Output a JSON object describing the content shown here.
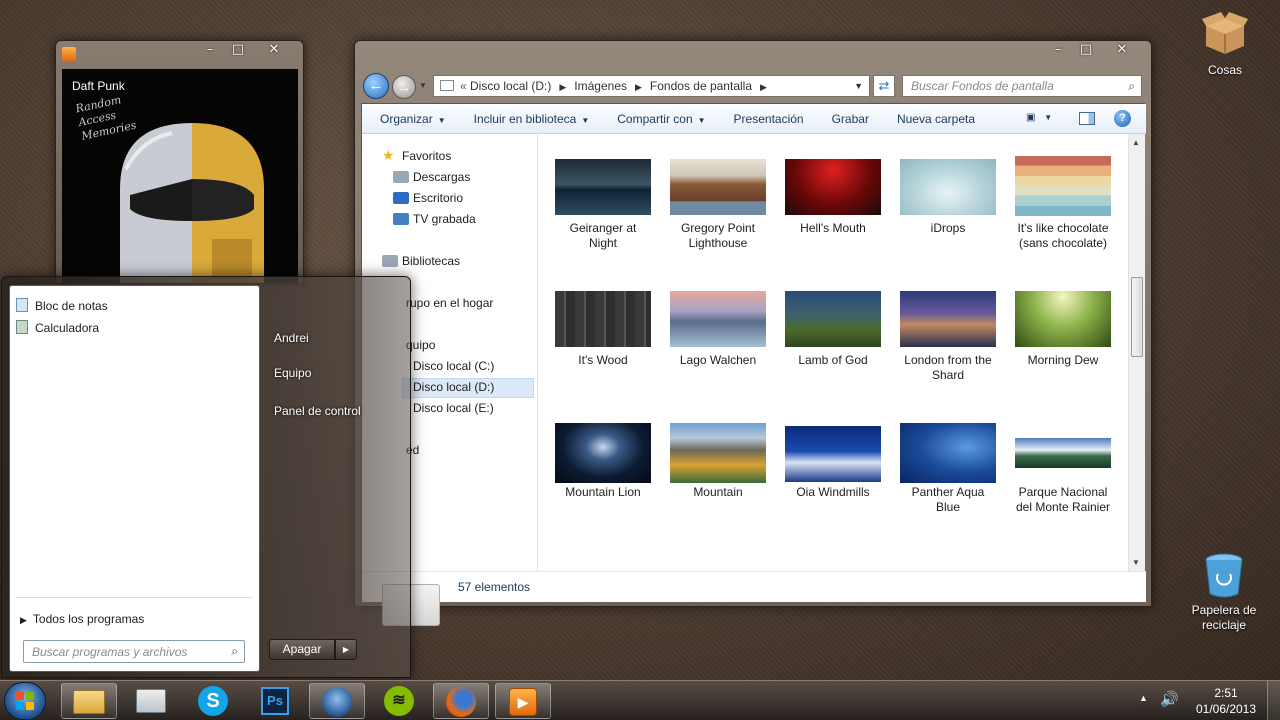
{
  "media_player": {
    "artist": "Daft Punk",
    "album_script": "Random Access Memories"
  },
  "explorer": {
    "breadcrumb": [
      "Disco local (D:)",
      "Imágenes",
      "Fondos de pantalla"
    ],
    "search_placeholder": "Buscar Fondos de pantalla",
    "toolbar": {
      "organize": "Organizar",
      "include": "Incluir en biblioteca",
      "share": "Compartir con",
      "slideshow": "Presentación",
      "burn": "Grabar",
      "new_folder": "Nueva carpeta"
    },
    "nav": {
      "favorites": "Favoritos",
      "downloads": "Descargas",
      "desktop": "Escritorio",
      "recorded_tv": "TV grabada",
      "libraries": "Bibliotecas",
      "homegroup_partial": "rupo en el hogar",
      "computer_partial": "quipo",
      "disk_c": "Disco local (C:)",
      "disk_d": "Disco local (D:)",
      "disk_e": "Disco local (E:)",
      "network_partial": "ed"
    },
    "files": [
      {
        "name": "Geiranger at\nNight"
      },
      {
        "name": "Gregory Point\nLighthouse"
      },
      {
        "name": "Hell's Mouth"
      },
      {
        "name": "iDrops"
      },
      {
        "name": "It's like chocolate\n(sans chocolate)"
      },
      {
        "name": "It's Wood"
      },
      {
        "name": "Lago Walchen"
      },
      {
        "name": "Lamb of God"
      },
      {
        "name": "London from the\nShard"
      },
      {
        "name": "Morning Dew"
      },
      {
        "name": "Mountain Lion"
      },
      {
        "name": "Mountain"
      },
      {
        "name": "Oia Windmills"
      },
      {
        "name": "Panther Aqua\nBlue"
      },
      {
        "name": "Parque Nacional\ndel Monte Rainier"
      }
    ],
    "status": "57 elementos"
  },
  "start_menu": {
    "programs": [
      "Bloc de notas",
      "Calculadora"
    ],
    "all_programs": "Todos los programas",
    "search_placeholder": "Buscar programas y archivos",
    "right": {
      "user": "Andrei",
      "computer": "Equipo",
      "control_panel": "Panel de control"
    },
    "shutdown": "Apagar"
  },
  "desktop": {
    "folder": "Cosas",
    "recycle_bin": "Papelera de\nreciclaje"
  },
  "tray": {
    "time": "2:51",
    "date": "01/06/2013"
  },
  "colors": {
    "accent_blue": "#1e3958",
    "selection": "#dce9f8"
  }
}
